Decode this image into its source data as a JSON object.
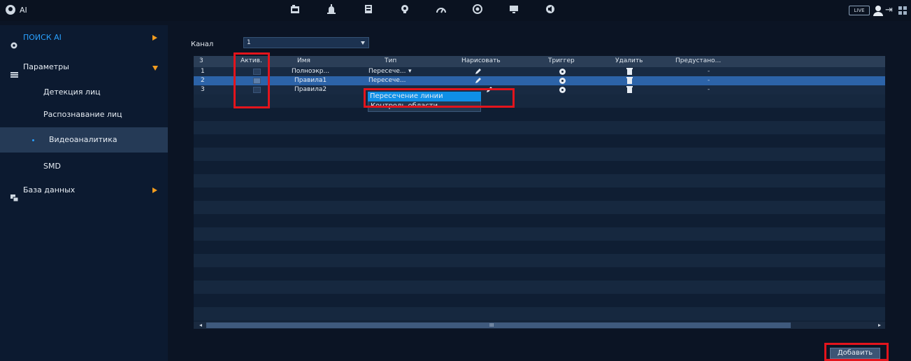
{
  "topbar": {
    "app_title": "AI",
    "live_label": "LIVE",
    "icons": [
      "camera-icon",
      "alarm-icon",
      "storage-icon",
      "ai-icon",
      "network-icon",
      "system-icon",
      "display-icon",
      "audio-icon"
    ]
  },
  "sidebar": {
    "items": [
      {
        "label": "ПОИСК AI",
        "color": "#2aa1ff"
      },
      {
        "label": "Параметры"
      },
      {
        "label": "Детекция лиц"
      },
      {
        "label": "Распознавание лиц"
      },
      {
        "label": "Видеоаналитика"
      },
      {
        "label": "SMD"
      },
      {
        "label": "База данных"
      }
    ]
  },
  "main": {
    "channel_label": "Канал",
    "channel_value": "1",
    "table": {
      "headers": [
        "3",
        "Актив.",
        "Имя",
        "Тип",
        "Нарисовать",
        "Триггер",
        "Удалить",
        "Предустано..."
      ],
      "rows": [
        {
          "num": "1",
          "checked": false,
          "name": "Полноэкр...",
          "type": "Пересече...",
          "preset": "-"
        },
        {
          "num": "2",
          "checked": true,
          "name": "Правила1",
          "type": "Пересече...",
          "preset": "-"
        },
        {
          "num": "3",
          "checked": false,
          "name": "Правила2",
          "type": "",
          "preset": "-"
        }
      ]
    },
    "type_dropdown_options": [
      "Пересечение линии",
      "Контроль области"
    ],
    "scroll_grip": "III",
    "add_button": "Добавить"
  },
  "colors": {
    "accent": "#2aa1ff",
    "selected_row": "#2c63a8",
    "annotation": "#e3141c",
    "arrow": "#f39c1e"
  }
}
